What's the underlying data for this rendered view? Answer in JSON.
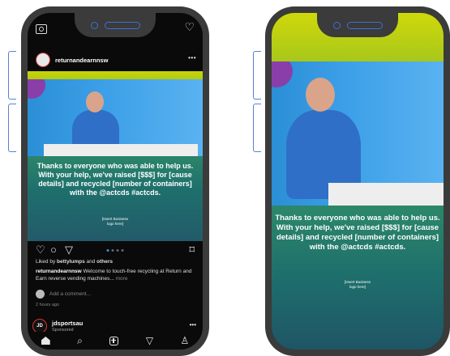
{
  "left_phone": {
    "account_name": "returnandearnnsw",
    "post": {
      "message": "Thanks to everyone who was able to help us. With your help, we've raised [$$$] for [cause details] and recycled [number of containers] with the @actcds #actcds.",
      "logo_placeholder_line1": "[Insert Business",
      "logo_placeholder_line2": "logo here]"
    },
    "liked_prefix": "Liked by ",
    "liked_user": "bettylumps",
    "liked_and": " and ",
    "liked_others": "others",
    "caption_user": "returnandearnnsw",
    "caption_text": " Welcome to touch-free recycling at Return and Earn reverse vending machines...",
    "caption_more": " more",
    "comment_placeholder": "Add a comment...",
    "time_ago": "2 hours ago",
    "sponsored_account": "jdsportsau",
    "sponsored_label": "Sponsored",
    "sponsored_avatar_text": "JD"
  },
  "right_phone": {
    "message": "Thanks to everyone who was able to help us. With your help, we've raised [$$$] for [cause details] and recycled [number of containers] with the @actcds #actcds.",
    "logo_placeholder_line1": "[Insert Business",
    "logo_placeholder_line2": "logo here]"
  },
  "icons": {
    "camera": "camera-icon",
    "heart": "heart-icon",
    "comment": "comment-icon",
    "share": "send-icon",
    "bookmark": "bookmark-icon",
    "home": "home-icon",
    "search": "search-icon",
    "add": "add-post-icon",
    "send": "send-icon",
    "profile": "profile-icon"
  },
  "colors": {
    "accent": "#3d6fd9",
    "post_gradient_top": "#c8d40a",
    "post_gradient_bottom": "#235a6a"
  }
}
